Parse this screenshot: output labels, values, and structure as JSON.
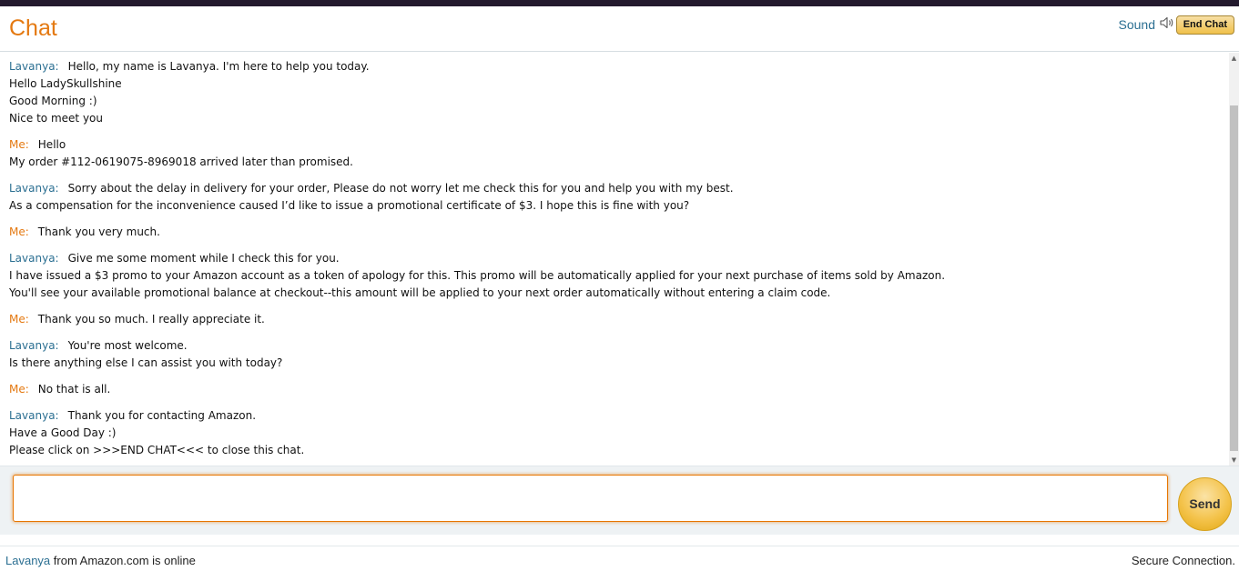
{
  "header": {
    "title": "Chat",
    "sound_label": "Sound",
    "sound_icon": "speaker-icon",
    "end_chat_label": "End Chat"
  },
  "messages": [
    {
      "sender": "Lavanya:",
      "role": "agent",
      "lines": [
        "Hello, my name is Lavanya. I'm here to help you today.",
        "Hello LadySkullshine",
        "Good Morning :)",
        "Nice to meet you"
      ]
    },
    {
      "sender": "Me:",
      "role": "me",
      "lines": [
        "Hello",
        "My order #112-0619075-8969018 arrived later than promised."
      ]
    },
    {
      "sender": "Lavanya:",
      "role": "agent",
      "lines": [
        "Sorry about the delay in delivery for your order, Please do not worry let me check this for you and help you with my best.",
        "As a compensation for the inconvenience caused I’d like to issue a promotional certificate of $3. I hope this is fine with you?"
      ]
    },
    {
      "sender": "Me:",
      "role": "me",
      "lines": [
        "Thank you very much."
      ]
    },
    {
      "sender": "Lavanya:",
      "role": "agent",
      "lines": [
        "Give me some moment while I check this for you.",
        "I have issued a $3 promo to your Amazon account as a token of apology for this. This promo will be automatically applied for your next purchase of items sold by Amazon.",
        "You'll see your available promotional balance at checkout--this amount will be applied to your next order automatically without entering a claim code."
      ]
    },
    {
      "sender": "Me:",
      "role": "me",
      "lines": [
        "Thank you so much. I really appreciate it."
      ]
    },
    {
      "sender": "Lavanya:",
      "role": "agent",
      "lines": [
        "You're most welcome.",
        "Is there anything else I can assist you with today?"
      ]
    },
    {
      "sender": "Me:",
      "role": "me",
      "lines": [
        "No that is all."
      ]
    },
    {
      "sender": "Lavanya:",
      "role": "agent",
      "lines": [
        "Thank you for contacting Amazon.",
        "Have a Good Day :)",
        "Please click on >>>END CHAT<<< to close this chat."
      ]
    }
  ],
  "composer": {
    "input_value": "",
    "send_label": "Send"
  },
  "footer": {
    "agent_name": "Lavanya",
    "status_text": " from Amazon.com is online",
    "secure_text": "Secure Connection."
  },
  "colors": {
    "accent_orange": "#e47911",
    "agent_blue": "#2b6f92",
    "top_bar": "#231a2e",
    "button_gold": "#f0c14b"
  }
}
